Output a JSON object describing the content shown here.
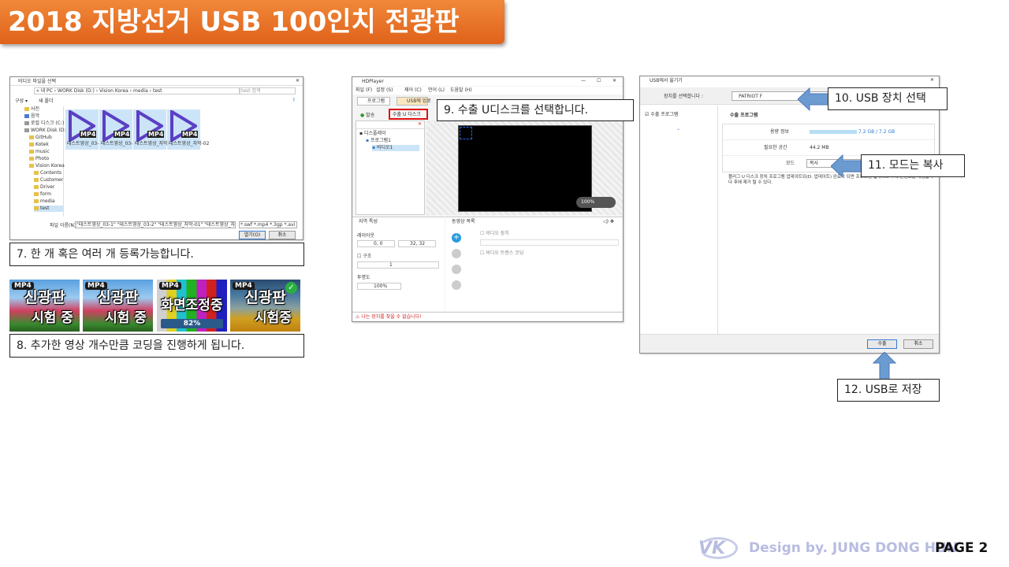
{
  "title": "2018 지방선거 USB 100인치 전광판",
  "file_dialog": {
    "title": "비디오 파일을 선택",
    "path": "« 내 PC › WORK Disk (D:) › Vision Korea › media › test",
    "search_placeholder": "test 검색",
    "toolbar": [
      "구성 ▾",
      "새 폴더"
    ],
    "tree": [
      "사진",
      "음악",
      "로컬 디스크 (C:)",
      "WORK Disk (D:)",
      "GitHub",
      "Kotek",
      "music",
      "Photo",
      "Vision Korea",
      "Contents",
      "Customer",
      "Driver",
      "form",
      "media",
      "test"
    ],
    "files": [
      {
        "badge": "MP4",
        "name": "테스트영상_03-1"
      },
      {
        "badge": "MP4",
        "name": "테스트영상_03-2"
      },
      {
        "badge": "MP4",
        "name": "테스트영상_자막-01"
      },
      {
        "badge": "MP4",
        "name": "테스트영상_자막-02"
      }
    ],
    "filename_label": "파일 이름(N):",
    "filename_value": "\"테스트영상_03-1\" \"테스트영상_03-2\" \"테스트영상_자막-01\" \"테스트영상_자막-02\"",
    "filter": "*.swf *.mp4 *.3gp *.avi *.rmvb",
    "open_button": "열기(O)",
    "cancel_button": "취소"
  },
  "caption7": "7. 한 개 혹은 여러 개 등록가능합니다.",
  "tiles": [
    {
      "badge": "MP4",
      "top": "신광판",
      "bottom": "시험 중",
      "check": false
    },
    {
      "badge": "MP4",
      "top": "신광판",
      "bottom": "시험 중",
      "check": false
    },
    {
      "badge": "MP4",
      "top": "화면조정중",
      "bottom": "",
      "progress": "82%",
      "check": false
    },
    {
      "badge": "MP4",
      "top": "신광판",
      "bottom": "시험중",
      "check": true
    }
  ],
  "caption8": "8. 추가한 영상 개수만큼 코딩을 진행하게 됩니다.",
  "hdplayer": {
    "title": "HDPlayer",
    "menu": [
      "파일 (F)",
      "설정 (S)",
      "제어 (C)",
      "언어 (L)",
      "도움말 (H)"
    ],
    "tab_program": "프로그램",
    "tab_usb": "USB에 업로",
    "send_label": "발송",
    "export_label": "수출 U 디스크",
    "tree": [
      "디스플레이",
      "프로그램1",
      "비디오1"
    ],
    "zoom": "100%",
    "area_header": "지역 특성",
    "video_list_header": "동영상 목록",
    "layout_label": "레이아웃",
    "pos_value": "0, 0",
    "size_value": "32, 32",
    "border_label": "구조",
    "border_value": "1",
    "transparency_label": "투명도",
    "transparency_value": "100%",
    "video_stretch": "비디오 장치",
    "video_transcode": "비디오 트랜스 코딩",
    "status": "나는 장치를 찾을 수 없습니다!"
  },
  "caption9": "9. 수출 U디스크를 선택합니다.",
  "usb_dialog": {
    "title": "USB에서 옮기기",
    "select_label": "장치를 선택합니다 :",
    "device": "PATRIOT F",
    "side_item": "수출 프로그램",
    "section_title": "수출 프로그램",
    "rows": [
      {
        "label": "용량 정보",
        "value": "7.2 GB / 7.2 GB"
      },
      {
        "label": "필요한 공간",
        "value": "44.2 MB"
      },
      {
        "label": "모드",
        "value": "복사"
      }
    ],
    "note": "플러그 U 디스크 장치 프로그램 업데이트되(D. 업데이트) 완료가 되면 프로그램 업데이트 후에 콘텐츠를 재생합니다 후에 제거 될 수 있다.",
    "export_button": "수출",
    "cancel_button": "취소"
  },
  "caption10": "10. USB 장치 선택",
  "caption11": "11. 모드는 복사",
  "caption12": "12. USB로 저장",
  "footer": {
    "logo": "VK",
    "design": "Design by. JUNG DONG HUN",
    "page": "PAGE 2"
  },
  "colors": {
    "accent": "#ea7530",
    "callout": "#6c9bd2",
    "highlight": "#e01010"
  }
}
